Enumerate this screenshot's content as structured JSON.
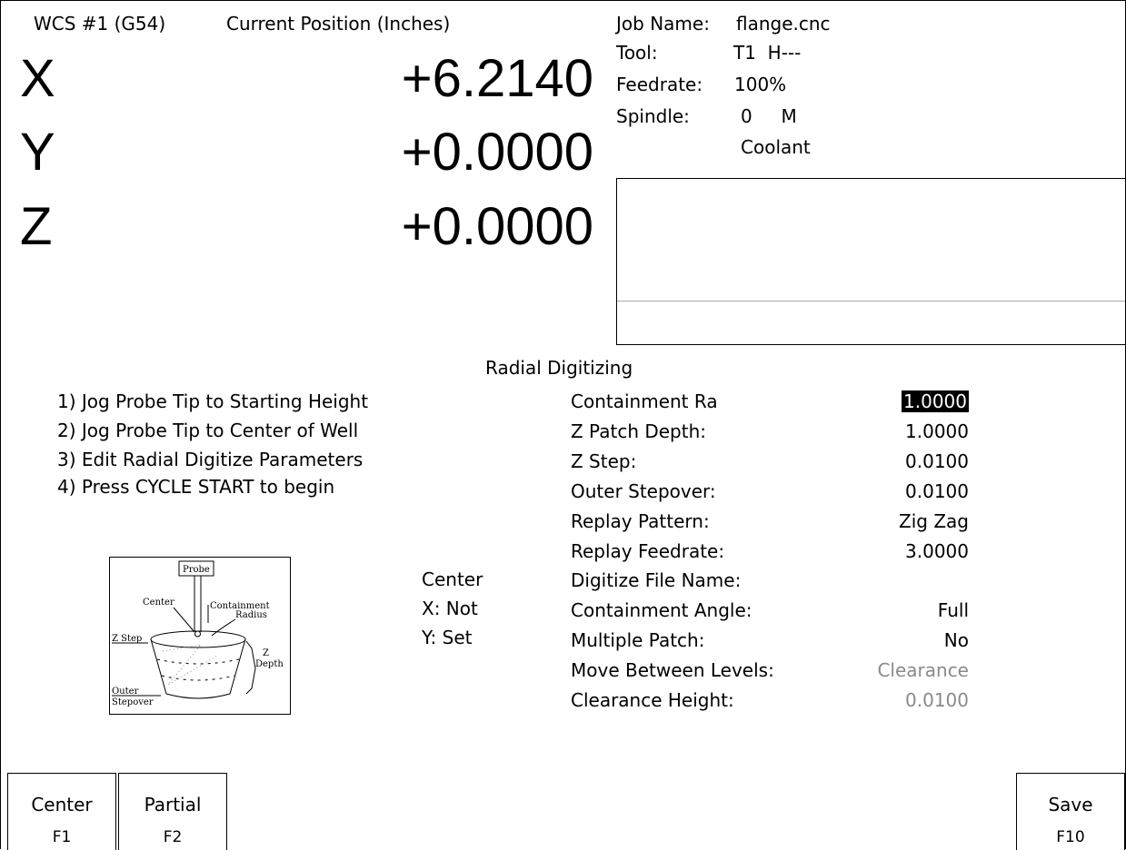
{
  "header": {
    "wcs": "WCS #1 (G54)",
    "position_title": "Current Position (Inches)"
  },
  "axes": [
    {
      "letter": "X",
      "value": "+6.2140"
    },
    {
      "letter": "Y",
      "value": "+0.0000"
    },
    {
      "letter": "Z",
      "value": "+0.0000"
    }
  ],
  "status": {
    "job_name_label": "Job Name:",
    "job_name": "flange.cnc",
    "tool_label": "Tool:",
    "tool_value": "T1  H---",
    "feedrate_label": "Feedrate:",
    "feedrate_value": "100%",
    "spindle_label": "Spindle:",
    "spindle_value": "0     M",
    "coolant": "Coolant"
  },
  "section_title": "Radial Digitizing",
  "instructions": [
    "1) Jog Probe Tip to Starting Height",
    "2) Jog Probe Tip to Center of Well",
    "3) Edit Radial Digitize Parameters",
    "4) Press CYCLE START to begin"
  ],
  "center_info": {
    "title": "Center",
    "x": "X: Not",
    "y": "Y: Set"
  },
  "diagram_labels": {
    "probe": "Probe",
    "center": "Center",
    "containment": "Containment",
    "radius": "Radius",
    "z_step": "Z Step",
    "z": "Z",
    "depth": "Depth",
    "outer": "Outer",
    "stepover": "Stepover"
  },
  "parameters": [
    {
      "label": "Containment Ra",
      "value": "1.0000",
      "state": "selected"
    },
    {
      "label": "Z Patch Depth:",
      "value": "1.0000",
      "state": "normal"
    },
    {
      "label": "Z Step:",
      "value": "0.0100",
      "state": "normal"
    },
    {
      "label": "Outer Stepover:",
      "value": "0.0100",
      "state": "normal"
    },
    {
      "label": "Replay Pattern:",
      "value": "Zig Zag",
      "state": "normal"
    },
    {
      "label": "Replay Feedrate:",
      "value": "3.0000",
      "state": "normal"
    },
    {
      "label": "Digitize File Name:",
      "value": "",
      "state": "normal"
    },
    {
      "label": "Containment Angle:",
      "value": "Full",
      "state": "normal"
    },
    {
      "label": "Multiple Patch:",
      "value": "No",
      "state": "normal"
    },
    {
      "label": "Move Between Levels:",
      "value": "Clearance",
      "state": "disabled"
    },
    {
      "label": "Clearance Height:",
      "value": "0.0100",
      "state": "disabled"
    }
  ],
  "fkeys": [
    {
      "label": "Center",
      "key": "F1"
    },
    {
      "label": "Partial",
      "key": "F2"
    },
    {
      "label": "Save",
      "key": "F10"
    }
  ]
}
